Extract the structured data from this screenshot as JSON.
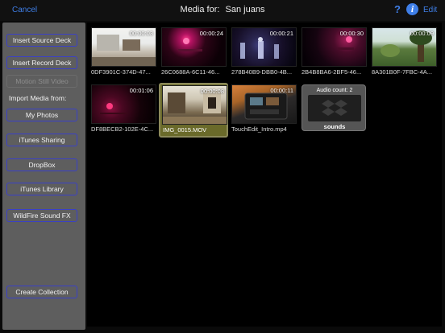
{
  "topbar": {
    "cancel_label": "Cancel",
    "title_prefix": "Media for:",
    "title_name": "San juans",
    "help_label": "?",
    "info_label": "i",
    "edit_label": "Edit",
    "accent_color": "#3f7fe8"
  },
  "sidebar": {
    "insert_source": "Insert Source Deck",
    "insert_record": "Insert Record Deck",
    "motion_still": "Motion Still Video",
    "import_label": "Import Media from:",
    "my_photos": "My Photos",
    "itunes_sharing": "iTunes Sharing",
    "dropbox": "DropBox",
    "itunes_library": "iTunes Library",
    "wildfire": "WildFire Sound FX",
    "create_collection": "Create Collection"
  },
  "media": [
    {
      "name": "0DF3901C-374D-47...",
      "duration": "00:00:03",
      "icon": "video-thumbnail"
    },
    {
      "name": "26C0688A-6C11-46...",
      "duration": "00:00:24",
      "icon": "video-thumbnail"
    },
    {
      "name": "278B40B9-DBB0-4B...",
      "duration": "00:00:21",
      "icon": "video-thumbnail"
    },
    {
      "name": "2B4B8BA6-2BF5-46...",
      "duration": "00:00:30",
      "icon": "video-thumbnail"
    },
    {
      "name": "8A301B0F-7FBC-4A...",
      "duration": "00:00:09",
      "icon": "video-thumbnail"
    },
    {
      "name": "DF8BECB2-102E-4C...",
      "duration": "00:01:06",
      "icon": "video-thumbnail"
    },
    {
      "name": "IMG_0015.MOV",
      "duration": "00:00:08",
      "icon": "video-thumbnail",
      "selected": true
    },
    {
      "name": "TouchEdit_Intro.mp4",
      "duration": "00:00:11",
      "icon": "video-thumbnail"
    }
  ],
  "folder": {
    "count_label": "Audio count: 2",
    "name": "sounds",
    "icon": "dropbox-icon"
  }
}
